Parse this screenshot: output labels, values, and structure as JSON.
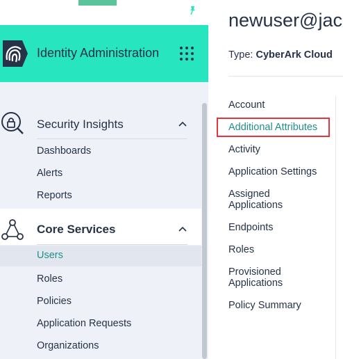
{
  "sidebar": {
    "brand_title": "Identity Administration",
    "sections": [
      {
        "title": "Security Insights",
        "icon": "security-insights-icon",
        "expanded": true,
        "items": [
          {
            "label": "Dashboards"
          },
          {
            "label": "Alerts"
          },
          {
            "label": "Reports"
          }
        ]
      },
      {
        "title": "Core Services",
        "icon": "core-services-icon",
        "expanded": true,
        "items": [
          {
            "label": "Users",
            "active": true
          },
          {
            "label": "Roles"
          },
          {
            "label": "Policies"
          },
          {
            "label": "Application Requests"
          },
          {
            "label": "Organizations"
          }
        ]
      }
    ]
  },
  "user": {
    "title": "newuser@jac",
    "type_label": "Type:",
    "type_value": "CyberArk Cloud"
  },
  "tabs": [
    {
      "label": "Account"
    },
    {
      "label": "Additional Attributes",
      "selected": true
    },
    {
      "label": "Activity"
    },
    {
      "label": "Application Settings"
    },
    {
      "label": "Assigned Applications"
    },
    {
      "label": "Endpoints"
    },
    {
      "label": "Roles"
    },
    {
      "label": "Provisioned Applications"
    },
    {
      "label": "Policy Summary"
    }
  ],
  "colors": {
    "brand_bar": "#27e6bf",
    "accent_text": "#1f8f8a",
    "highlight_box": "#e5353b",
    "sidebar_bg": "#eef1f7"
  }
}
